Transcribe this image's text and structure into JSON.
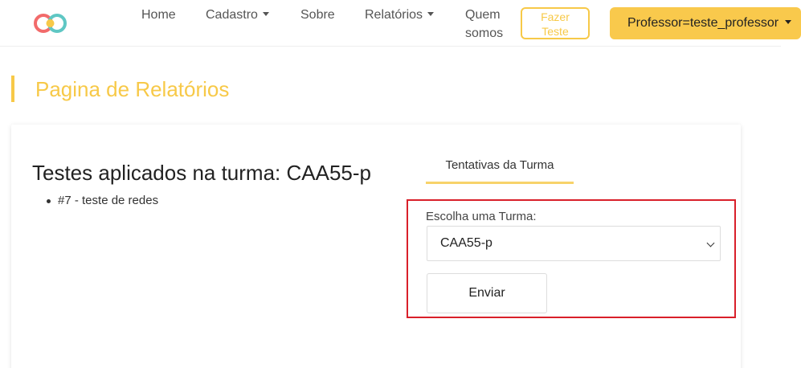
{
  "navbar": {
    "logo_icon": "brand-logo-icon",
    "items": [
      {
        "label": "Home"
      },
      {
        "label": "Cadastro",
        "has_dropdown": true
      },
      {
        "label": "Sobre"
      },
      {
        "label": "Relatórios",
        "has_dropdown": true
      },
      {
        "label_line1": "Quem",
        "label_line2": "somos"
      }
    ],
    "cta": {
      "line1": "Fazer",
      "line2": "Teste"
    },
    "user_menu": {
      "label": "Professor=teste_professor"
    },
    "colors": {
      "accent": "#f7c948"
    }
  },
  "page": {
    "title": "Pagina de Relatórios"
  },
  "card": {
    "heading": "Testes aplicados na turma: CAA55-p",
    "tests": [
      "#7 - teste de redes"
    ],
    "tab_label": "Tentativas da Turma",
    "form": {
      "label": "Escolha uma Turma:",
      "selected_value": "CAA55-p",
      "submit_label": "Enviar"
    }
  }
}
